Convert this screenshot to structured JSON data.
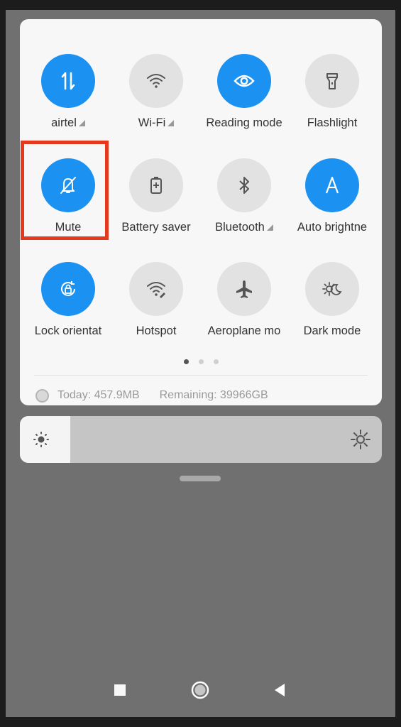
{
  "tiles": [
    {
      "label": "airtel",
      "icon": "mobile-data-icon",
      "active": true,
      "signal": true
    },
    {
      "label": "Wi-Fi",
      "icon": "wifi-icon",
      "active": false,
      "signal": true
    },
    {
      "label": "Reading mode",
      "icon": "eye-icon",
      "active": true,
      "signal": false
    },
    {
      "label": "Flashlight",
      "icon": "flashlight-icon",
      "active": false,
      "signal": false
    },
    {
      "label": "Mute",
      "icon": "bell-off-icon",
      "active": true,
      "signal": false
    },
    {
      "label": "Battery saver",
      "icon": "battery-saver-icon",
      "active": false,
      "signal": false
    },
    {
      "label": "Bluetooth",
      "icon": "bluetooth-icon",
      "active": false,
      "signal": true
    },
    {
      "label": "Auto brightne",
      "icon": "auto-brightness-icon",
      "active": true,
      "signal": false
    },
    {
      "label": "Lock orientat",
      "icon": "rotation-lock-icon",
      "active": true,
      "signal": false
    },
    {
      "label": "Hotspot",
      "icon": "hotspot-icon",
      "active": false,
      "signal": false
    },
    {
      "label": "Aeroplane mo",
      "icon": "airplane-icon",
      "active": false,
      "signal": false
    },
    {
      "label": "Dark mode",
      "icon": "dark-mode-icon",
      "active": false,
      "signal": false
    }
  ],
  "pager": {
    "pages": 3,
    "current": 1
  },
  "usage": {
    "today": "Today: 457.9MB",
    "remaining": "Remaining: 39966GB"
  },
  "brightness": {
    "level": 0.14
  },
  "colors": {
    "accent": "#1b91f2",
    "highlight": "#e5391d",
    "tile_off": "#e2e2e2"
  },
  "nav": [
    "recents-button",
    "home-button",
    "back-button"
  ]
}
